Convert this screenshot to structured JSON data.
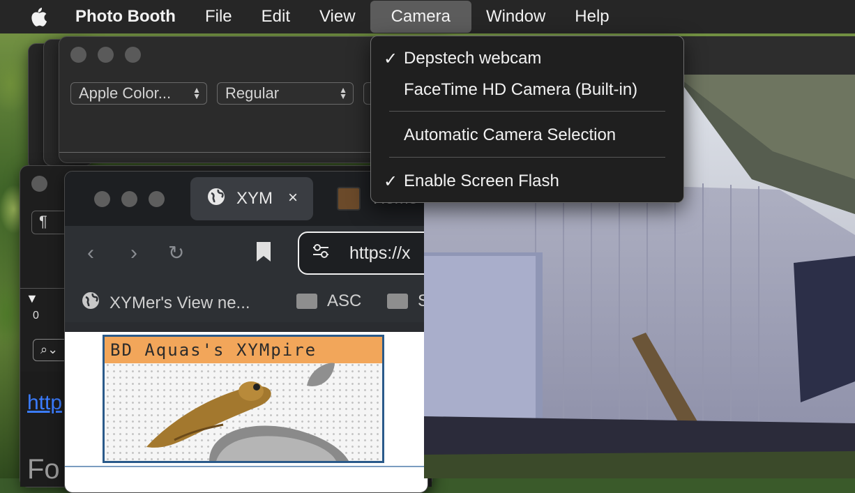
{
  "menubar": {
    "app_name": "Photo Booth",
    "items": [
      "File",
      "Edit",
      "View",
      "Camera",
      "Window",
      "Help"
    ]
  },
  "camera_menu": {
    "items": [
      {
        "label": "Depstech webcam",
        "checked": true
      },
      {
        "label": "FaceTime HD Camera (Built-in)",
        "checked": false
      },
      {
        "label": "Automatic Camera Selection",
        "checked": false
      },
      {
        "label": "Enable Screen Flash",
        "checked": true
      }
    ],
    "checkmark": "✓"
  },
  "fonts_window": {
    "family": "Apple Color...",
    "style": "Regular"
  },
  "textedit": {
    "paragraph_symbol": "¶",
    "ruler_zero": "0",
    "link_fragment": "http",
    "big_fragment": "Fo"
  },
  "browser": {
    "tab_title": "XYM",
    "tab_close": "×",
    "tab2_title": "Home",
    "url": "https://x",
    "bookmarks": [
      {
        "label": "XYMer's View ne...",
        "icon": "globe-icon"
      },
      {
        "label": "ASC",
        "icon": "folder-icon"
      },
      {
        "label": "S",
        "icon": "folder-icon"
      }
    ],
    "banner_title": "BD Aquas's XYMpire"
  }
}
